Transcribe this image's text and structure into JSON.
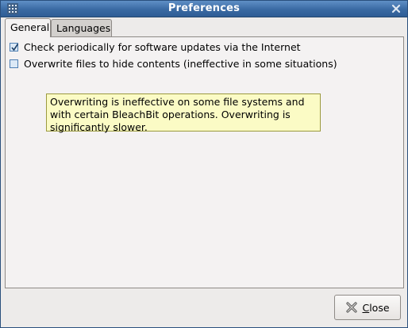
{
  "window": {
    "title": "Preferences"
  },
  "tabs": [
    {
      "label": "General",
      "selected": true
    },
    {
      "label": "Languages",
      "selected": false
    }
  ],
  "general": {
    "options": [
      {
        "label": "Check periodically for software updates via the Internet",
        "checked": true
      },
      {
        "label": "Overwrite files to hide contents (ineffective in some situations)",
        "checked": false
      }
    ],
    "tooltip": "Overwriting is ineffective on some file systems and with certain BleachBit operations.  Overwriting is significantly slower."
  },
  "buttons": {
    "close_mnemonic": "C",
    "close_rest": "lose"
  },
  "icons": {
    "app": "bleachbit-app-icon",
    "window_close": "close-icon",
    "button_close": "x-icon",
    "check": "checkmark-icon"
  },
  "colors": {
    "titlebar": "#3a6aa3",
    "tooltip_bg": "#fbfbc5",
    "dialog_bg": "#edebea"
  }
}
